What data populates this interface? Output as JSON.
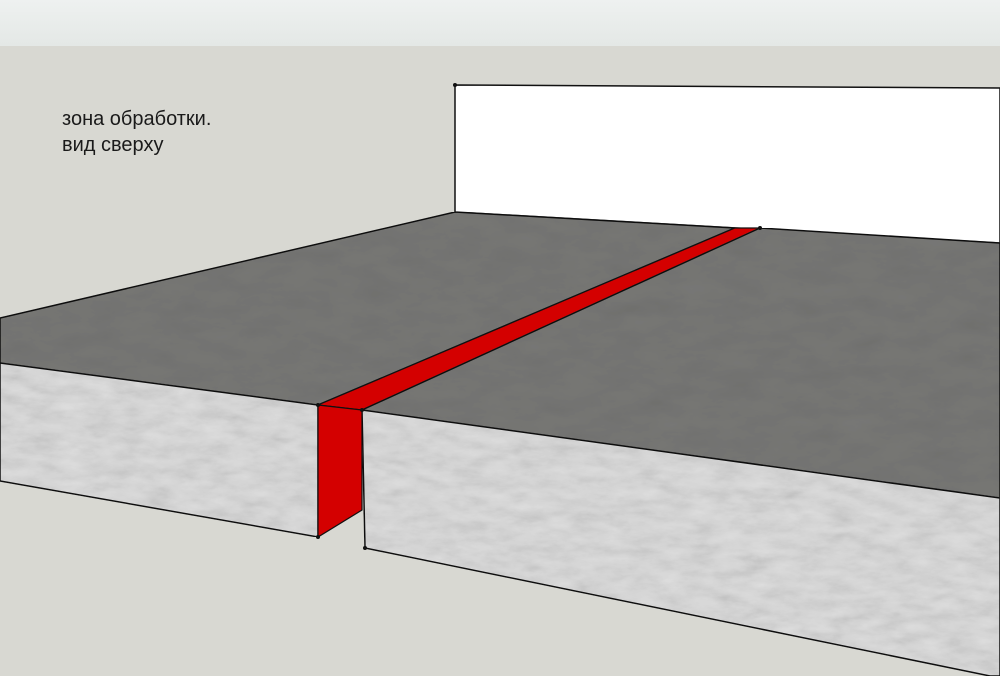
{
  "annotation": {
    "line1": "зона обработки.",
    "line2": "вид сверху"
  },
  "colors": {
    "background": "#d8d8d2",
    "wall": "#ffffff",
    "slab_top": "#777775",
    "slab_side": "#dcdcdc",
    "joint_highlight": "#d40000",
    "edge": "#111111"
  }
}
